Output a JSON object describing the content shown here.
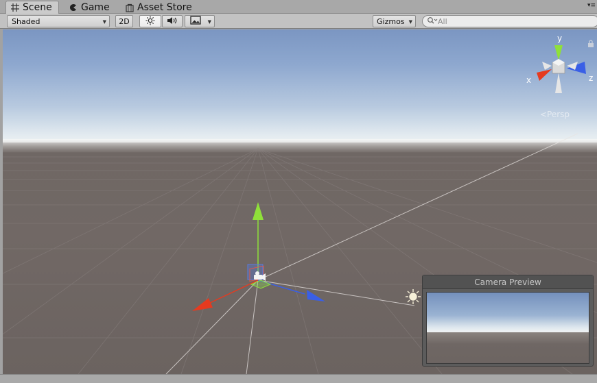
{
  "tabs": [
    {
      "label": "Scene",
      "icon": "scene-grid-icon",
      "active": true
    },
    {
      "label": "Game",
      "icon": "game-pacman-icon",
      "active": false
    },
    {
      "label": "Asset Store",
      "icon": "asset-store-bag-icon",
      "active": false
    }
  ],
  "toolbar": {
    "shading_mode": "Shaded",
    "mode_2d_label": "2D",
    "lighting_icon": "sun-icon",
    "audio_icon": "speaker-icon",
    "effects_icon": "image-icon",
    "gizmos_label": "Gizmos",
    "search_placeholder": "All"
  },
  "scene": {
    "view_mode_label": "<Persp",
    "axis_labels": {
      "x": "x",
      "y": "y",
      "z": "z"
    },
    "colors": {
      "sky_top": "#7b96c2",
      "horizon": "#f2f4f4",
      "ground": "#716865",
      "axis_x": "#e63a1f",
      "axis_y": "#8fe03a",
      "axis_z": "#3a5fe6"
    }
  },
  "camera_preview": {
    "title": "Camera Preview"
  }
}
